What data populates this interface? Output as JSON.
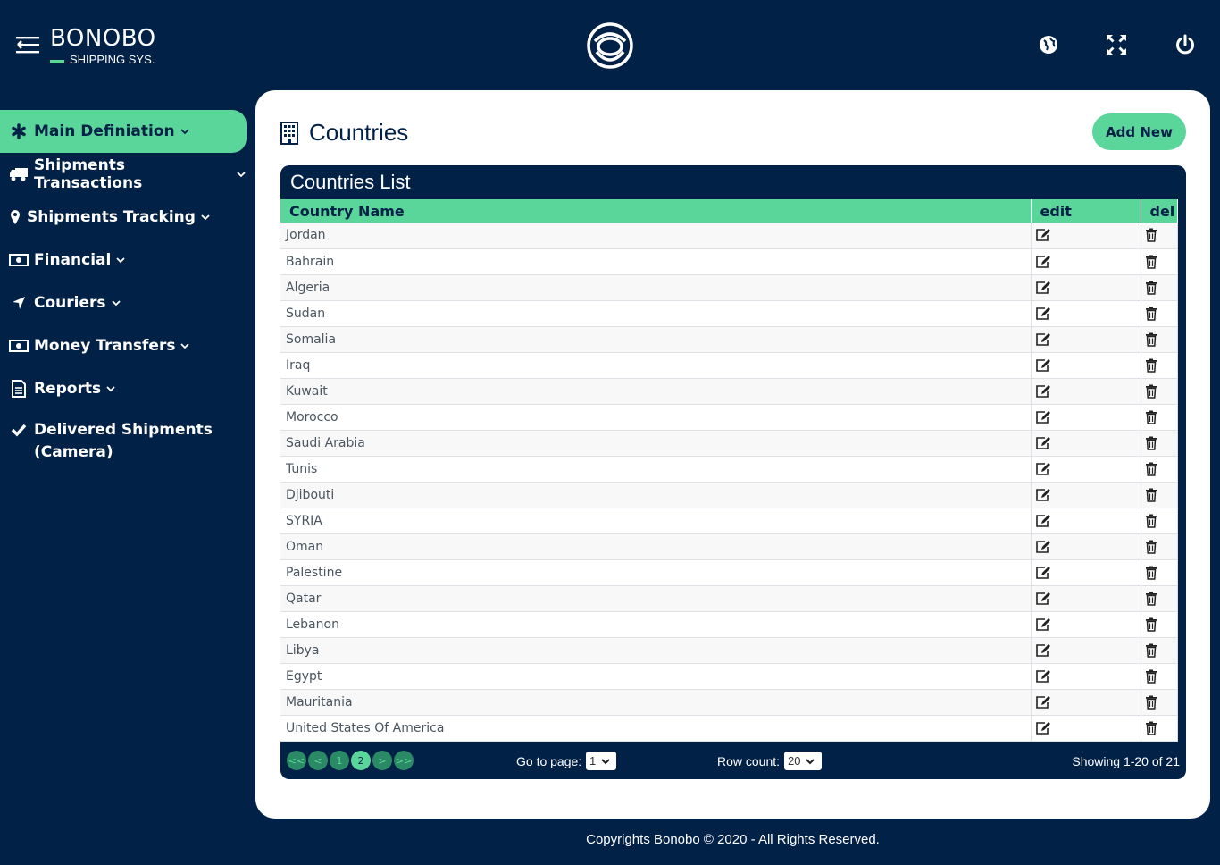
{
  "brand": {
    "name": "BONOBO",
    "subtitle": "SHIPPING SYS."
  },
  "header_icons": [
    "globe-icon",
    "fullscreen-icon",
    "power-icon"
  ],
  "sidebar": {
    "items": [
      {
        "label": "Main Definiation",
        "icon": "asterisk-icon",
        "active": true
      },
      {
        "label": "Shipments Transactions",
        "icon": "truck-icon"
      },
      {
        "label": "Shipments Tracking",
        "icon": "map-marker-icon"
      },
      {
        "label": "Financial",
        "icon": "money-bill-icon"
      },
      {
        "label": "Couriers",
        "icon": "location-arrow-icon"
      },
      {
        "label": "Money Transfers",
        "icon": "money-bill-icon"
      },
      {
        "label": "Reports",
        "icon": "document-icon"
      },
      {
        "label_line1": "Delivered Shipments",
        "label_line2": "(Camera)",
        "icon": "check-icon"
      }
    ]
  },
  "page": {
    "title": "Countries",
    "add_button": "Add New"
  },
  "list": {
    "title": "Countries List",
    "columns": [
      "Country Name",
      "edit",
      "del"
    ],
    "rows": [
      "Jordan",
      "Bahrain",
      "Algeria",
      "Sudan",
      "Somalia",
      "Iraq",
      "Kuwait",
      "Morocco",
      "Saudi Arabia",
      "Tunis",
      "Djibouti",
      "SYRIA",
      "Oman",
      "Palestine",
      "Qatar",
      "Lebanon",
      "Libya",
      "Egypt",
      "Mauritania",
      "United States Of America"
    ]
  },
  "pager": {
    "buttons": [
      "<<",
      "<",
      "1",
      "2",
      ">",
      ">>"
    ],
    "current": "2",
    "goto_label": "Go to page:",
    "goto_value": "1",
    "rowcount_label": "Row count:",
    "rowcount_value": "20",
    "showing": "Showing 1-20 of 21"
  },
  "footer": "Copyrights Bonobo © 2020 - All Rights Reserved.",
  "colors": {
    "navy": "#022147",
    "accent": "#5ad69a"
  }
}
